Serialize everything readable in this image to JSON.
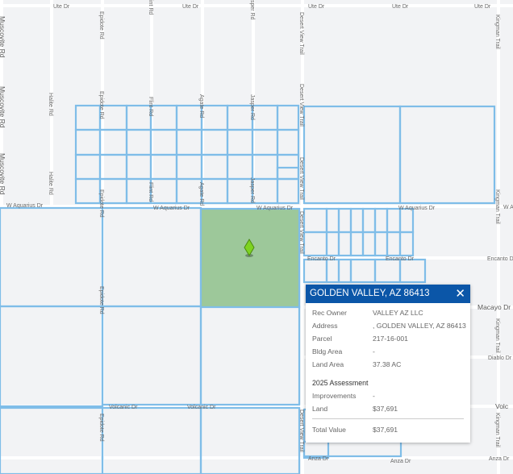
{
  "map": {
    "highlight_color": "#9dc89a",
    "parcel_color": "#7fbde8",
    "pin_color": "#7ed321",
    "streets": {
      "ute": "Ute Dr",
      "aquarius": "W Aquarius Dr",
      "aquarius_short": "W A",
      "encanto": "Encanto Dr",
      "macayo": "Macayo Dr",
      "diablo": "Diablo Dr",
      "volcanic": "Volcanic Dr",
      "volcanic_short": "Volc",
      "anza": "Anza Dr",
      "muscovite": "Muscovite Rd",
      "halite": "Halite Rd",
      "epidote": "Epidote Rd",
      "flint": "Flint Rd",
      "flint_cut": "int Rd",
      "agate": "Agate Rd",
      "jasper": "Jasper Rd",
      "jasper_cut": "sper Rd",
      "desert_view": "Desert View Trail",
      "kingman": "Kingman Trail"
    }
  },
  "popup": {
    "title": "GOLDEN VALLEY, AZ 86413",
    "close_icon": "close-icon",
    "fields": [
      {
        "label": "Rec Owner",
        "value": "VALLEY AZ LLC"
      },
      {
        "label": "Address",
        "value": ", GOLDEN VALLEY, AZ 86413"
      },
      {
        "label": "Parcel",
        "value": "217-16-001"
      },
      {
        "label": "Bldg Area",
        "value": "-"
      },
      {
        "label": "Land Area",
        "value": "37.38 AC"
      }
    ],
    "assessment_title": "2025 Assessment",
    "assessment": [
      {
        "label": "Improvements",
        "value": "-"
      },
      {
        "label": "Land",
        "value": "$37,691"
      }
    ],
    "total": {
      "label": "Total Value",
      "value": "$37,691"
    }
  }
}
